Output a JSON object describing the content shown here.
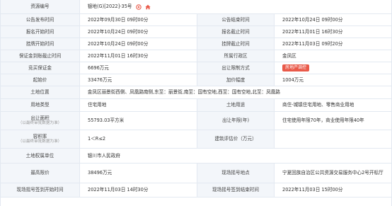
{
  "rows": [
    {
      "label": "资源编号",
      "value": "银地(G)[2022]-35号"
    },
    {
      "label": "公告发布时间",
      "value": "2022年09月30日 09时00分",
      "label2": "公告结束时间",
      "value2": "2022年10月24日 09时00分"
    },
    {
      "label": "报名开始时间",
      "value": "2022年10月24日 09时00分",
      "label2": "报名截止时间",
      "value2": "2022年11月01日 16时30分"
    },
    {
      "label": "挂牌开始时间",
      "value": "2022年10月24日 09时00分",
      "label2": "挂牌截止时间",
      "value2": "2022年11月03日 09时20分"
    },
    {
      "label": "保证金到账截止时间",
      "value": "2022年11月01日 16时30分",
      "label2": "所属行政区",
      "value2": "金凤区"
    },
    {
      "label": "竞买保证金",
      "value": "6696万元",
      "label2": "出让限制方式",
      "tag": "房地产调控"
    },
    {
      "label": "起始价",
      "value": "33476万元",
      "label2": "加价幅度",
      "value2": "1004万元"
    },
    {
      "label": "土地位置",
      "value": "金凤区丽景街西侧、凤凰路南侧,东至：丽景街,南至：国有空地,西至：国有空地,北至：凤凰路"
    },
    {
      "label": "用地类型",
      "value": "住宅用地",
      "label2": "土地用途",
      "value2": "商住-城镇住宅用地、零售商业用地"
    },
    {
      "label": "出让面积",
      "sub": "（以最终审批数据为准）",
      "value": "55793.03平方米",
      "label2": "出让年限(年)",
      "value2": "住宅使用年限70年，商业使用年限40年"
    },
    {
      "label": "容积率",
      "sub": "（以最终审批数据为准）",
      "value": "1＜R≤2",
      "label2": "建筑评估价（万元）",
      "value2": ""
    },
    {
      "label": "土地权属单位",
      "value": "银川市人民政府"
    },
    {
      "label": "最高限价",
      "value": "38496万元",
      "label2": "现场摇号地点",
      "value2": "宁夏回族自治区公共资源交易服务中心2号开标厅"
    },
    {
      "label": "现场摇号签到开始时间",
      "value": "2022年11月03日 14时30分",
      "label2": "现场摇号签到结束时间",
      "value2": "2022年11月03日 15时00分"
    }
  ],
  "icons": {
    "target": "target-icon",
    "home": "home-icon"
  },
  "colors": {
    "accent": "#e95a4a",
    "label_bg": "#f3f6fa",
    "border": "#e3e9f1"
  }
}
